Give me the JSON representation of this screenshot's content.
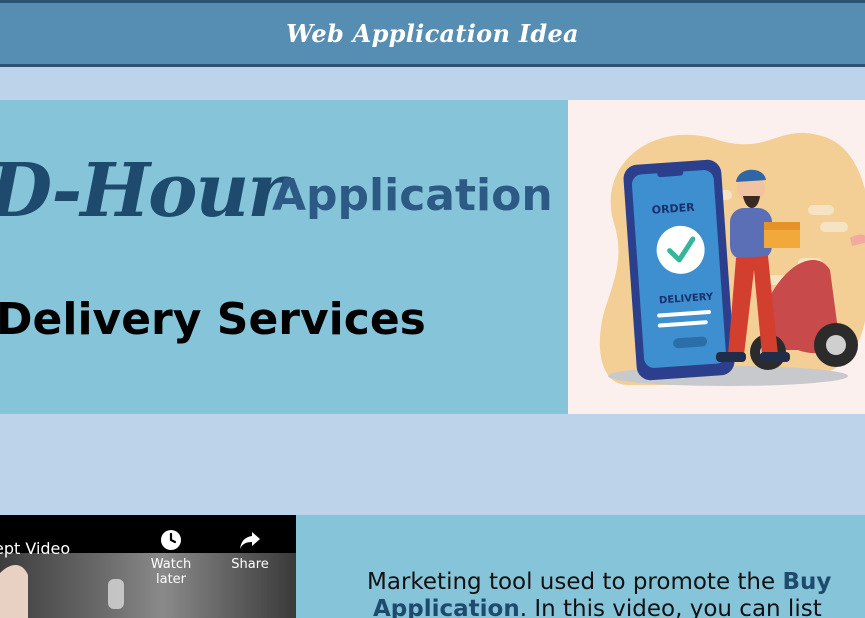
{
  "header": {
    "title": "Web Application Idea"
  },
  "hero": {
    "brand": "D-Hour",
    "app_word": "Application",
    "subtitle": "Delivery Services",
    "illustration": {
      "order_label": "ORDER",
      "delivery_label": "DELIVERY"
    }
  },
  "video": {
    "title": "ept Video",
    "watch_later_label": "Watch later",
    "share_label": "Share"
  },
  "info": {
    "text_prefix": "Marketing tool used to promote the ",
    "highlight_1": "Buy",
    "highlight_2": "Application",
    "text_suffix": ". In this video, you can list"
  },
  "colors": {
    "header_bg": "#568db2",
    "page_bg": "#bdd3ea",
    "panel_bg": "#86c5d9",
    "brand_text": "#1e4a6e"
  }
}
